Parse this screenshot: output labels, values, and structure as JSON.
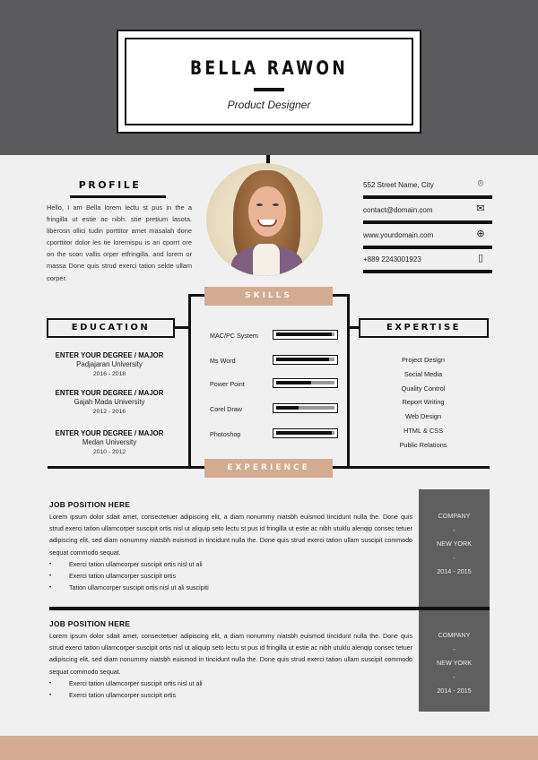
{
  "header": {
    "name": "BELLA RAWON",
    "title": "Product Designer"
  },
  "profile": {
    "heading": "PROFILE",
    "text": "Hello, I am Bella lorem lectu st pus in the a fringilla ut  estie ac nibh. stie pretium lasota. liberosn ollici tudin porttitor amet masalah done cporttitor dolor les tie loremispu is an cporrt ore on the scon vallis orper etfringilla. and lorem or massa Done quis strud exerci tation sekte ullam corper."
  },
  "contacts": [
    {
      "text": "552 Street Name, City",
      "icon": "location-pin-icon",
      "glyph": "⌾"
    },
    {
      "text": "contact@domain.com",
      "icon": "envelope-icon",
      "glyph": "✉"
    },
    {
      "text": "www.yourdomain.com",
      "icon": "globe-icon",
      "glyph": "⊕"
    },
    {
      "text": "+889 2243001923",
      "icon": "mobile-phone-icon",
      "glyph": "▯"
    }
  ],
  "skills": {
    "heading": "SKILLS",
    "items": [
      {
        "name": "MAC/PC System",
        "level": 0.95
      },
      {
        "name": "Ms Word",
        "level": 0.9
      },
      {
        "name": "Power Point",
        "level": 0.6
      },
      {
        "name": "Corel Draw",
        "level": 0.38
      },
      {
        "name": "Photoshop",
        "level": 0.95
      }
    ]
  },
  "education": {
    "heading": "EDUCATION",
    "entries": [
      {
        "degree": "ENTER YOUR DEGREE / MAJOR",
        "school": "Padjajaran University",
        "years": "2016 - 2018"
      },
      {
        "degree": "ENTER YOUR DEGREE / MAJOR",
        "school": "Gajah Mada University",
        "years": "2012 - 2016"
      },
      {
        "degree": "ENTER YOUR DEGREE / MAJOR",
        "school": "Medan University",
        "years": "2010 - 2012"
      }
    ]
  },
  "expertise": {
    "heading": "EXPERTISE",
    "items": [
      "Project Design",
      "Social Media",
      "Quality Control",
      "Report Writing",
      "Web Design",
      "HTML & CSS",
      "Public Relations"
    ]
  },
  "experience": {
    "heading": "EXPERIENCE",
    "jobs": [
      {
        "title": "JOB POSITION HERE",
        "description": "Lorem ipsum dolor sdait amet, consectetuer adipiscing elit, a diam nonummy niatsbh euismod tincidunt nulla the. Done quis strud exerci tation ullamcorper suscipit ortis nisl ut aliquip seto lectu st pus id fringilla ut  estie ac nibh utuklu alenqip consec tetuer adipiscing elit, sed diam nonummy niatsbh euismod in tincidunt nulla the. Done quis strud exerci tation ullam suscipit commodo sequat commodo sequat.",
        "bullets": [
          "Exerci tation ullamcorper suscipit ortis nisl ut ali",
          "Exerci tation ullamcorper suscipit ortis",
          "Tation ullamcorper suscipit ortis nisl ut ali suscipiti"
        ],
        "company": "COMPANY",
        "sep1": "-",
        "location": "NEW YORK",
        "sep2": "-",
        "years": "2014 - 2015"
      },
      {
        "title": "JOB POSITION HERE",
        "description": "Lorem ipsum dolor sdait amet, consectetuer adipiscing elit, a diam nonummy niatsbh euismod tincidunt nulla the. Done quis strud exerci tation ullamcorper suscipit ortis nisl ut aliquip seto lectu st pus id fringilla ut  estie ac nibh utuklu alenqip consec tetuer adipiscing elit, sed diam nonummy niatsbh euismod in tincidunt nulla the. Done quis strud exerci tation ullam suscipit commodo sequat commodo sequat.",
        "bullets": [
          "Exerci tation ullamcorper suscipit ortis nisl ut ali",
          "Exerci tation ullamcorper suscipit ortis"
        ],
        "company": "COMPANY",
        "sep1": "-",
        "location": "NEW YORK",
        "sep2": "-",
        "years": "2014 - 2015"
      }
    ]
  }
}
